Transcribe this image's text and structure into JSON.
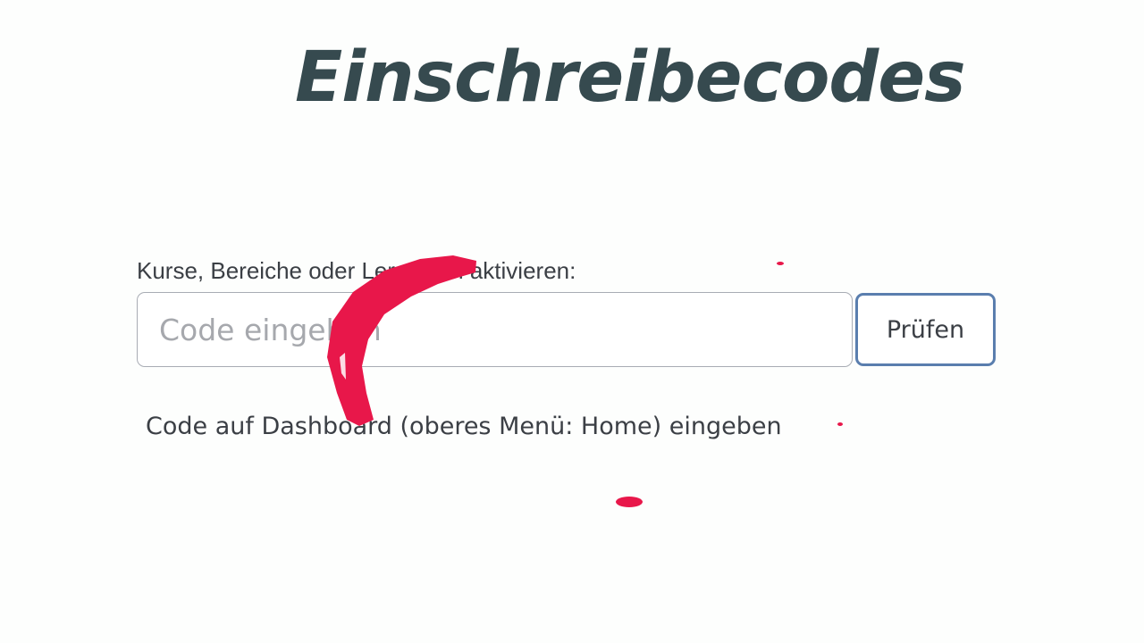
{
  "header": {
    "title": "Einschreibecodes"
  },
  "form": {
    "label": "Kurse, Bereiche oder Lernmittel aktivieren:",
    "input_value": "",
    "input_placeholder": "Code eingeben",
    "button_label": "Prüfen"
  },
  "hint": {
    "text": "Code auf Dashboard (oberes Menü: Home) eingeben"
  },
  "colors": {
    "title": "#364a4f",
    "text": "#3b3f45",
    "button_border": "#5a7eae",
    "input_border": "#a8acb4",
    "annotation": "#e8174a"
  }
}
